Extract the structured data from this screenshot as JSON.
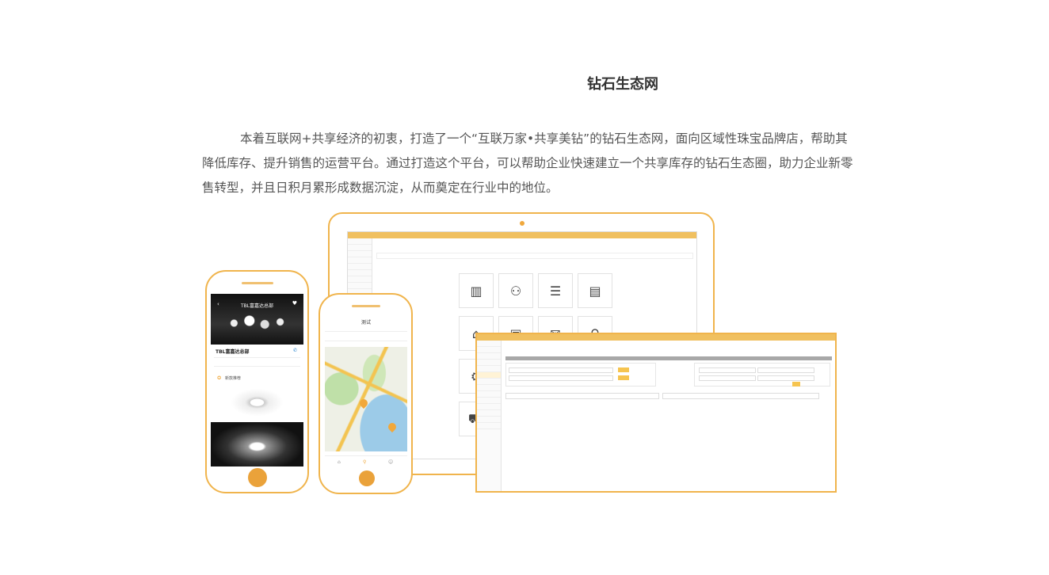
{
  "heading": "钻石生态网",
  "intro": "本着互联网+共享经济的初衷，打造了一个“互联万家•共享美钻”的钻石生态网，面向区域性珠宝品牌店，帮助其降低库存、提升销售的运营平台。通过打造这个平台，可以帮助企业快速建立一个共享库存的钻石生态圈，助力企业新零售转型，并且日积月累形成数据沉淀，从而奠定在行业中的地位。",
  "phone_left": {
    "banner_title": "TBL富嘉达总部",
    "shop_name": "TBL富嘉达总部",
    "section": "新款推荐"
  },
  "phone_middle": {
    "title": "测试"
  },
  "colors": {
    "accent": "#f0b44c",
    "home_button": "#eaa23a",
    "admin_bar": "#f0c060"
  }
}
